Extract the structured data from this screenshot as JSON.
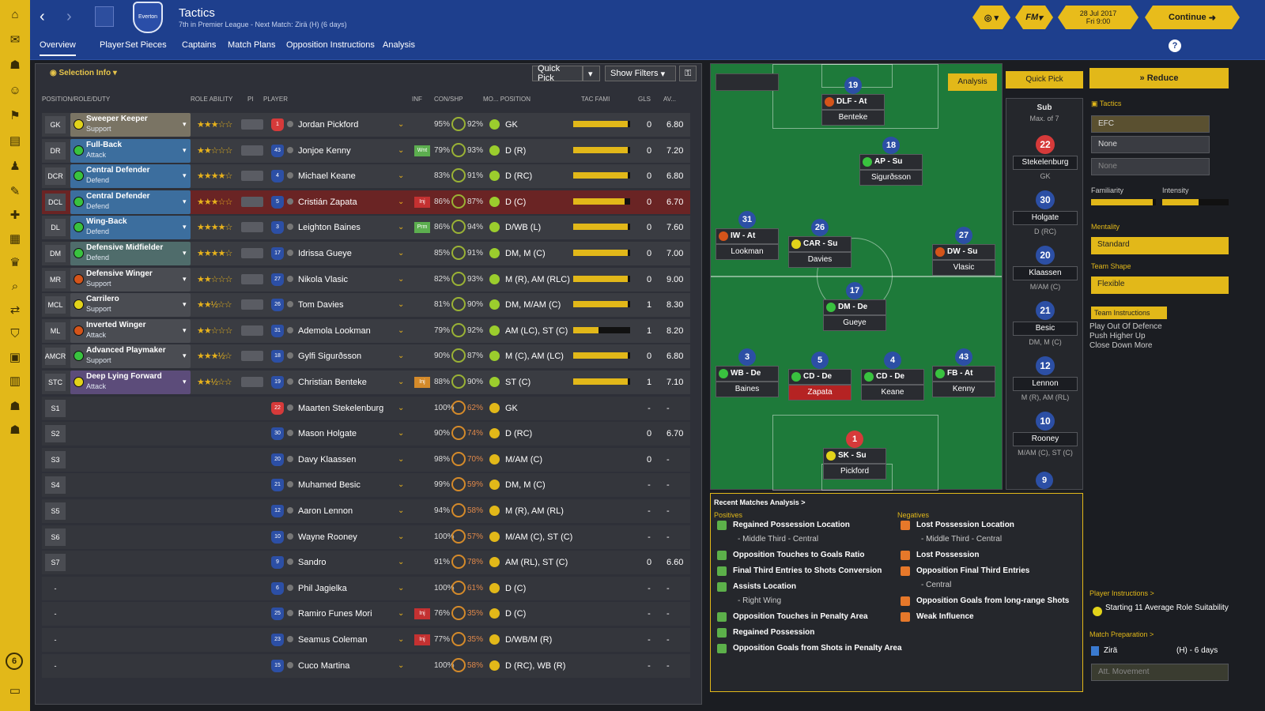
{
  "header": {
    "title": "Tactics",
    "subtitle": "7th in Premier League - Next Match: Zirä (H) (6 days)",
    "crest_text": "Everton",
    "date_line1": "28 Jul 2017",
    "date_line2": "Fri 9:00",
    "continue_label": "Continue",
    "fm_label": "FM"
  },
  "tabs": [
    "Overview",
    "Player",
    "Set Pieces",
    "Captains",
    "Match Plans",
    "Opposition Instructions",
    "Analysis"
  ],
  "toolbar": {
    "selection_info": "Selection Info",
    "quick_pick": "Quick Pick",
    "show_filters": "Show Filters"
  },
  "columns": {
    "position": "POSITION/ROLE/DUTY",
    "role_ability": "ROLE ABILITY",
    "pi": "PI",
    "player": "PLAYER",
    "inf": "INF",
    "con_shp": "CON/SHP",
    "mo_position": "MO... POSITION",
    "tac_fam": "TAC FAMI",
    "gls": "GLS",
    "av": "AV..."
  },
  "starters": [
    {
      "pos": "GK",
      "role": "Sweeper Keeper",
      "duty": "Support",
      "num": "1",
      "name": "Jordan Pickford",
      "cond": "95%",
      "shp": "92%",
      "position": "GK",
      "gls": "0",
      "av": "6.80",
      "dot": "#e2d31a",
      "color": "#7a7464",
      "gk": true,
      "inf": "",
      "fam": 0.95,
      "stars": "★★★☆☆"
    },
    {
      "pos": "DR",
      "role": "Full-Back",
      "duty": "Attack",
      "num": "43",
      "name": "Jonjoe Kenny",
      "cond": "79%",
      "shp": "93%",
      "position": "D (R)",
      "gls": "0",
      "av": "7.20",
      "dot": "#39c23f",
      "color": "#3c6e9e",
      "inf": "Wnt",
      "infc": "#5cae4f",
      "fam": 0.95,
      "stars": "★★☆☆☆"
    },
    {
      "pos": "DCR",
      "role": "Central Defender",
      "duty": "Defend",
      "num": "4",
      "name": "Michael Keane",
      "cond": "83%",
      "shp": "91%",
      "position": "D (RC)",
      "gls": "0",
      "av": "6.80",
      "dot": "#39c23f",
      "color": "#3c6e9e",
      "inf": "",
      "fam": 0.95,
      "stars": "★★★★☆"
    },
    {
      "pos": "DCL",
      "role": "Central Defender",
      "duty": "Defend",
      "num": "5",
      "name": "Cristián Zapata",
      "cond": "86%",
      "shp": "87%",
      "position": "D (C)",
      "gls": "0",
      "av": "6.70",
      "dot": "#39c23f",
      "color": "#3c6e9e",
      "inf": "Inj",
      "infc": "#c43131",
      "red": true,
      "fam": 0.9,
      "stars": "★★★☆☆"
    },
    {
      "pos": "DL",
      "role": "Wing-Back",
      "duty": "Defend",
      "num": "3",
      "name": "Leighton Baines",
      "cond": "86%",
      "shp": "94%",
      "position": "D/WB (L)",
      "gls": "0",
      "av": "7.60",
      "dot": "#39c23f",
      "color": "#3c6e9e",
      "inf": "Prm",
      "infc": "#5cae4f",
      "fam": 0.95,
      "stars": "★★★★☆"
    },
    {
      "pos": "DM",
      "role": "Defensive Midfielder",
      "duty": "Defend",
      "num": "17",
      "name": "Idrissa Gueye",
      "cond": "85%",
      "shp": "91%",
      "position": "DM, M (C)",
      "gls": "0",
      "av": "7.00",
      "dot": "#39c23f",
      "color": "#4f6c6b",
      "inf": "",
      "fam": 0.95,
      "stars": "★★★★☆"
    },
    {
      "pos": "MR",
      "role": "Defensive Winger",
      "duty": "Support",
      "num": "27",
      "name": "Nikola Vlasic",
      "cond": "82%",
      "shp": "93%",
      "position": "M (R), AM (RLC)",
      "gls": "0",
      "av": "9.00",
      "dot": "#d4541a",
      "color": "#4a4c52",
      "inf": "",
      "fam": 0.95,
      "stars": "★★☆☆☆"
    },
    {
      "pos": "MCL",
      "role": "Carrilero",
      "duty": "Support",
      "num": "26",
      "name": "Tom Davies",
      "cond": "81%",
      "shp": "90%",
      "position": "DM, M/AM (C)",
      "gls": "1",
      "av": "8.30",
      "dot": "#e2d31a",
      "color": "#4a4c52",
      "inf": "",
      "fam": 0.95,
      "stars": "★★½☆☆"
    },
    {
      "pos": "ML",
      "role": "Inverted Winger",
      "duty": "Attack",
      "num": "31",
      "name": "Ademola Lookman",
      "cond": "79%",
      "shp": "92%",
      "position": "AM (LC), ST (C)",
      "gls": "1",
      "av": "8.20",
      "dot": "#d4541a",
      "color": "#4a4c52",
      "inf": "",
      "fam": 0.4,
      "stars": "★★☆☆☆"
    },
    {
      "pos": "AMCR",
      "role": "Advanced Playmaker",
      "duty": "Support",
      "num": "18",
      "name": "Gylfi Sigurðsson",
      "cond": "90%",
      "shp": "87%",
      "position": "M (C), AM (LC)",
      "gls": "0",
      "av": "6.80",
      "dot": "#39c23f",
      "color": "#4a4c52",
      "inf": "",
      "fam": 0.95,
      "stars": "★★★½☆"
    },
    {
      "pos": "STC",
      "role": "Deep Lying Forward",
      "duty": "Attack",
      "num": "19",
      "name": "Christian Benteke",
      "cond": "88%",
      "shp": "90%",
      "position": "ST (C)",
      "gls": "1",
      "av": "7.10",
      "dot": "#e2d31a",
      "color": "#5c4c7a",
      "inf": "Inj",
      "infc": "#d48a2a",
      "fam": 0.95,
      "stars": "★★½☆☆"
    }
  ],
  "subs": [
    {
      "pos": "S1",
      "num": "22",
      "name": "Maarten Stekelenburg",
      "cond": "100%",
      "shp": "62%",
      "position": "GK",
      "gls": "-",
      "av": "-",
      "gk": true
    },
    {
      "pos": "S2",
      "num": "30",
      "name": "Mason Holgate",
      "cond": "90%",
      "shp": "74%",
      "position": "D (RC)",
      "gls": "0",
      "av": "6.70"
    },
    {
      "pos": "S3",
      "num": "20",
      "name": "Davy Klaassen",
      "cond": "98%",
      "shp": "70%",
      "position": "M/AM (C)",
      "gls": "0",
      "av": "-"
    },
    {
      "pos": "S4",
      "num": "21",
      "name": "Muhamed Besic",
      "cond": "99%",
      "shp": "59%",
      "position": "DM, M (C)",
      "gls": "-",
      "av": "-"
    },
    {
      "pos": "S5",
      "num": "12",
      "name": "Aaron Lennon",
      "cond": "94%",
      "shp": "58%",
      "position": "M (R), AM (RL)",
      "gls": "-",
      "av": "-"
    },
    {
      "pos": "S6",
      "num": "10",
      "name": "Wayne Rooney",
      "cond": "100%",
      "shp": "57%",
      "position": "M/AM (C), ST (C)",
      "gls": "-",
      "av": "-"
    },
    {
      "pos": "S7",
      "num": "9",
      "name": "Sandro",
      "cond": "91%",
      "shp": "78%",
      "position": "AM (RL), ST (C)",
      "gls": "0",
      "av": "6.60"
    },
    {
      "pos": "-",
      "num": "6",
      "name": "Phil Jagielka",
      "cond": "100%",
      "shp": "61%",
      "position": "D (C)",
      "gls": "-",
      "av": "-"
    },
    {
      "pos": "-",
      "num": "25",
      "name": "Ramiro Funes Mori",
      "cond": "76%",
      "shp": "35%",
      "position": "D (C)",
      "gls": "-",
      "av": "-",
      "inf": "Inj"
    },
    {
      "pos": "-",
      "num": "23",
      "name": "Seamus Coleman",
      "cond": "77%",
      "shp": "35%",
      "position": "D/WB/M (R)",
      "gls": "-",
      "av": "-",
      "inf": "Inj"
    },
    {
      "pos": "-",
      "num": "15",
      "name": "Cuco Martina",
      "cond": "100%",
      "shp": "58%",
      "position": "D (RC), WB (R)",
      "gls": "-",
      "av": "-"
    }
  ],
  "pitch": {
    "analysis_label": "Analysis",
    "players": [
      {
        "num": "19",
        "role": "DLF - At",
        "name": "Benteke",
        "dot": "#d4541a"
      },
      {
        "num": "18",
        "role": "AP - Su",
        "name": "Sigurðsson",
        "dot": "#39c23f"
      },
      {
        "num": "31",
        "role": "IW - At",
        "name": "Lookman",
        "dot": "#d4541a"
      },
      {
        "num": "26",
        "role": "CAR - Su",
        "name": "Davies",
        "dot": "#e2d31a"
      },
      {
        "num": "27",
        "role": "DW - Su",
        "name": "Vlasic",
        "dot": "#d4541a"
      },
      {
        "num": "17",
        "role": "DM - De",
        "name": "Gueye",
        "dot": "#39c23f"
      },
      {
        "num": "3",
        "role": "WB - De",
        "name": "Baines",
        "dot": "#39c23f"
      },
      {
        "num": "5",
        "role": "CD - De",
        "name": "Zapata",
        "dot": "#39c23f"
      },
      {
        "num": "4",
        "role": "CD - De",
        "name": "Keane",
        "dot": "#39c23f"
      },
      {
        "num": "43",
        "role": "FB - At",
        "name": "Kenny",
        "dot": "#39c23f"
      },
      {
        "num": "1",
        "role": "SK - Su",
        "name": "Pickford",
        "dot": "#e2d31a"
      }
    ]
  },
  "subs_panel": {
    "quick_pick": "Quick Pick",
    "title": "Sub",
    "max": "Max. of 7",
    "list": [
      {
        "num": "22",
        "name": "Stekelenburg",
        "pos": "GK",
        "gk": true
      },
      {
        "num": "30",
        "name": "Holgate",
        "pos": "D (RC)"
      },
      {
        "num": "20",
        "name": "Klaassen",
        "pos": "M/AM (C)"
      },
      {
        "num": "21",
        "name": "Besic",
        "pos": "DM, M (C)"
      },
      {
        "num": "12",
        "name": "Lennon",
        "pos": "M (R), AM (RL)"
      },
      {
        "num": "10",
        "name": "Rooney",
        "pos": "M/AM (C), ST (C)"
      }
    ],
    "last_num": "9"
  },
  "tactics": {
    "reduce_label": "Reduce",
    "tactics_label": "Tactics",
    "slot1": "EFC",
    "slot2": "None",
    "slot3": "None",
    "familiarity_label": "Familiarity",
    "intensity_label": "Intensity",
    "mentality_label": "Mentality",
    "mentality_value": "Standard",
    "team_shape_label": "Team Shape",
    "team_shape_value": "Flexible",
    "team_instructions_label": "Team Instructions",
    "instructions": [
      "Play Out Of Defence",
      "Push Higher Up",
      "Close Down More"
    ],
    "player_instructions_label": "Player Instructions >",
    "starting_suitability": "Starting 11 Average Role Suitability",
    "match_prep_label": "Match Preparation >",
    "opponent": "Zirä",
    "opponent_info": "(H) - 6 days",
    "att_movement": "Att. Movement"
  },
  "analysis": {
    "title": "Recent Matches Analysis >",
    "positives_label": "Positives",
    "negatives_label": "Negatives",
    "positives": [
      {
        "t": "Regained Possession Location",
        "s": "- Middle Third - Central"
      },
      {
        "t": "Opposition Touches to Goals Ratio",
        "s": ""
      },
      {
        "t": "Final Third Entries to Shots Conversion",
        "s": ""
      },
      {
        "t": "Assists Location",
        "s": "- Right Wing"
      },
      {
        "t": "Opposition Touches in Penalty Area",
        "s": ""
      },
      {
        "t": "Regained Possession",
        "s": ""
      },
      {
        "t": "Opposition Goals from Shots in Penalty Area",
        "s": ""
      }
    ],
    "negatives": [
      {
        "t": "Lost Possession Location",
        "s": "- Middle Third - Central"
      },
      {
        "t": "Lost Possession",
        "s": ""
      },
      {
        "t": "Opposition Final Third Entries",
        "s": "- Central"
      },
      {
        "t": "Opposition Goals from long-range Shots",
        "s": ""
      },
      {
        "t": "Weak Influence",
        "s": ""
      }
    ]
  },
  "sidebar_badge": "6"
}
